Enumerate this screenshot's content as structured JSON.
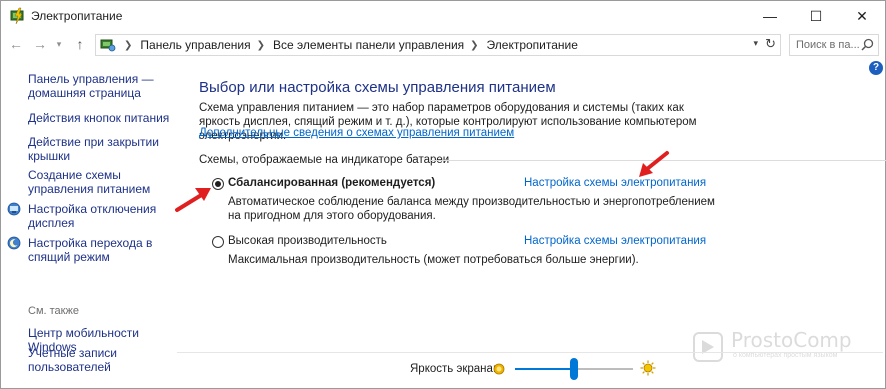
{
  "window": {
    "title": "Электропитание",
    "controls": {
      "minimize": "—",
      "maximize": "☐",
      "close": "✕"
    }
  },
  "navigation": {
    "back": "←",
    "forward": "→",
    "recent": "▾",
    "up": "↑",
    "breadcrumbs": [
      "Панель управления",
      "Все элементы панели управления",
      "Электропитание"
    ],
    "dropdown": "▾",
    "refresh": "↻",
    "search_placeholder": "Поиск в па...",
    "search_icon": "search-icon"
  },
  "help": {
    "label": "?"
  },
  "sidebar": {
    "links": [
      "Панель управления — домашняя страница",
      "Действия кнопок питания",
      "Действие при закрытии крышки",
      "Создание схемы управления питанием",
      "Настройка отключения дисплея",
      "Настройка перехода в спящий режим"
    ],
    "see_also_title": "См. также",
    "see_also_links": [
      "Центр мобильности Windows",
      "Учетные записи пользователей"
    ]
  },
  "main": {
    "title": "Выбор или настройка схемы управления питанием",
    "description": "Схема управления питанием — это набор параметров оборудования и системы (таких как яркость дисплея, спящий режим и т. д.), которые контролируют использование компьютером электроэнергии.",
    "more_info_link": "Дополнительные сведения о схемах управления питанием",
    "group_label": "Схемы, отображаемые на индикаторе батареи",
    "plans": [
      {
        "name": "Сбалансированная (рекомендуется)",
        "selected": true,
        "settings_link": "Настройка схемы электропитания",
        "description": "Автоматическое соблюдение баланса между производительностью и энергопотреблением на пригодном для этого оборудования."
      },
      {
        "name": "Высокая производительность",
        "selected": false,
        "settings_link": "Настройка схемы электропитания",
        "description": "Максимальная производительность (может потребоваться больше энергии)."
      }
    ]
  },
  "brightness": {
    "label": "Яркость экрана:",
    "value_fraction": 0.5
  },
  "watermark": {
    "brand": "ProstoComp",
    "tagline": "о компьютерах простым языком"
  },
  "colors": {
    "link": "#0066cc",
    "heading": "#1e3287",
    "slider": "#0078d7",
    "annotation_arrow": "#e02020"
  }
}
